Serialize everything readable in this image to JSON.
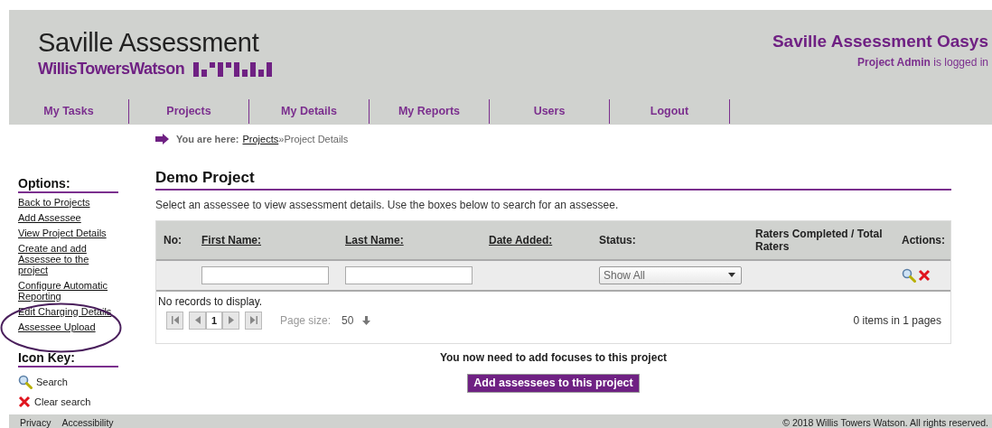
{
  "header": {
    "title": "Saville Assessment",
    "brand": "WillisTowersWatson",
    "app_title": "Saville Assessment Oasys",
    "user": "Project Admin",
    "login_suffix": "is logged in"
  },
  "nav": [
    {
      "label": "My Tasks"
    },
    {
      "label": "Projects"
    },
    {
      "label": "My Details"
    },
    {
      "label": "My Reports"
    },
    {
      "label": "Users"
    },
    {
      "label": "Logout"
    }
  ],
  "breadcrumb": {
    "label": "You are here:",
    "link": "Projects",
    "separator": "»",
    "current": "Project Details"
  },
  "sidebar": {
    "options_title": "Options:",
    "options": [
      {
        "label": "Back to Projects"
      },
      {
        "label": "Add Assessee"
      },
      {
        "label": "View Project Details"
      },
      {
        "label": "Create and add Assessee to the project"
      },
      {
        "label": "Configure Automatic Reporting"
      },
      {
        "label": "Edit Charging Details"
      },
      {
        "label": "Assessee Upload"
      }
    ],
    "icon_key_title": "Icon Key:",
    "icon_key": [
      {
        "kind": "search",
        "label": "Search"
      },
      {
        "kind": "clear",
        "label": "Clear search"
      }
    ]
  },
  "main": {
    "title": "Demo Project",
    "instructions": "Select an assessee to view assessment details. Use the boxes below to search for an assessee.",
    "table": {
      "columns": [
        {
          "label": "No:",
          "sortable": false
        },
        {
          "label": "First Name:",
          "sortable": true
        },
        {
          "label": "Last Name:",
          "sortable": true
        },
        {
          "label": "Date Added:",
          "sortable": true
        },
        {
          "label": "Status:",
          "sortable": false
        },
        {
          "label": "Raters Completed / Total Raters",
          "sortable": false
        },
        {
          "label": "Actions:",
          "sortable": false
        }
      ],
      "status_filter": "Show All",
      "empty_text": "No records to display.",
      "pager": {
        "page": "1",
        "page_size_label": "Page size:",
        "page_size": "50"
      },
      "summary": "0 items in 1 pages"
    },
    "notice": "You now need to add focuses to this project",
    "add_button": "Add assessees to this project"
  },
  "footer": {
    "links": [
      "Privacy",
      "Accessibility"
    ],
    "copyright": "© 2018 Willis Towers Watson. All rights reserved."
  }
}
